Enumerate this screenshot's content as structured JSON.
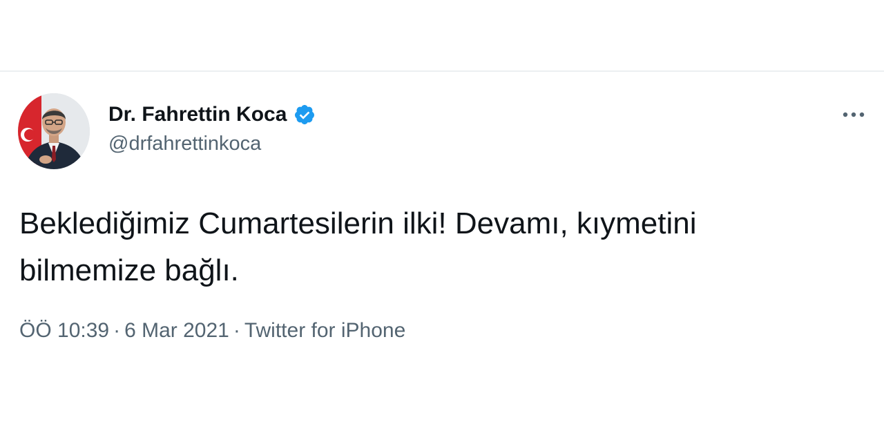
{
  "tweet": {
    "author": {
      "display_name": "Dr. Fahrettin Koca",
      "handle": "@drfahrettinkoca",
      "verified": true,
      "avatar_icon": "profile-photo"
    },
    "text": "Beklediğimiz Cumartesilerin ilki! Devamı, kıymetini\nbilmemize bağlı.",
    "time": "ÖÖ 10:39",
    "date": "6 Mar 2021",
    "source": "Twitter for iPhone",
    "separator": "·",
    "more_icon": "more-options-icon"
  },
  "colors": {
    "primary_text": "#0f1419",
    "secondary_text": "#536471",
    "verified_blue": "#1d9bf0",
    "divider": "#eceff1"
  }
}
